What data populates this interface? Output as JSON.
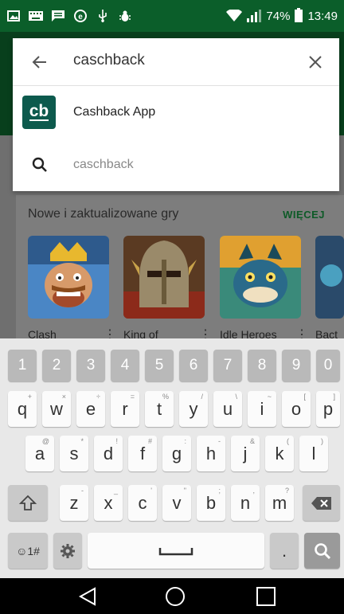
{
  "status_bar": {
    "icons": [
      "gallery-icon",
      "keyboard-icon",
      "message-icon",
      "e-icon",
      "usb-icon",
      "debug-icon"
    ],
    "battery": "74%",
    "time": "13:49"
  },
  "search": {
    "query": "caschback",
    "suggestions": [
      {
        "label": "Cashback App",
        "icon": "cb",
        "kind": "app"
      },
      {
        "label": "caschback",
        "kind": "query"
      }
    ]
  },
  "background": {
    "section_title": "Nowe i zaktualizowane gry",
    "more_link": "WIĘCEJ",
    "apps": [
      {
        "label": "Clash",
        "color": "#3b6ea5"
      },
      {
        "label": "King of",
        "color": "#6b4a2a"
      },
      {
        "label": "Idle Heroes",
        "color": "#2f6a6a"
      },
      {
        "label": "Bact",
        "color": "#2a4a6a"
      }
    ]
  },
  "keyboard": {
    "numbers": [
      "1",
      "2",
      "3",
      "4",
      "5",
      "6",
      "7",
      "8",
      "9",
      "0"
    ],
    "row1": [
      {
        "k": "q",
        "h": "+"
      },
      {
        "k": "w",
        "h": "×"
      },
      {
        "k": "e",
        "h": "÷"
      },
      {
        "k": "r",
        "h": "="
      },
      {
        "k": "t",
        "h": "%"
      },
      {
        "k": "y",
        "h": "/"
      },
      {
        "k": "u",
        "h": "\\"
      },
      {
        "k": "i",
        "h": "~"
      },
      {
        "k": "o",
        "h": "["
      },
      {
        "k": "p",
        "h": "]"
      }
    ],
    "row2": [
      {
        "k": "a",
        "h": "@"
      },
      {
        "k": "s",
        "h": "*"
      },
      {
        "k": "d",
        "h": "!"
      },
      {
        "k": "f",
        "h": "#"
      },
      {
        "k": "g",
        "h": ":"
      },
      {
        "k": "h",
        "h": "-"
      },
      {
        "k": "j",
        "h": "&"
      },
      {
        "k": "k",
        "h": "("
      },
      {
        "k": "l",
        "h": ")"
      }
    ],
    "row3": [
      {
        "k": "z",
        "h": "-"
      },
      {
        "k": "x",
        "h": "_"
      },
      {
        "k": "c",
        "h": "'"
      },
      {
        "k": "v",
        "h": "\""
      },
      {
        "k": "b",
        "h": ";"
      },
      {
        "k": "n",
        "h": ","
      },
      {
        "k": "m",
        "h": "?"
      }
    ],
    "symbols_label": "☺1#",
    "period_label": "."
  }
}
